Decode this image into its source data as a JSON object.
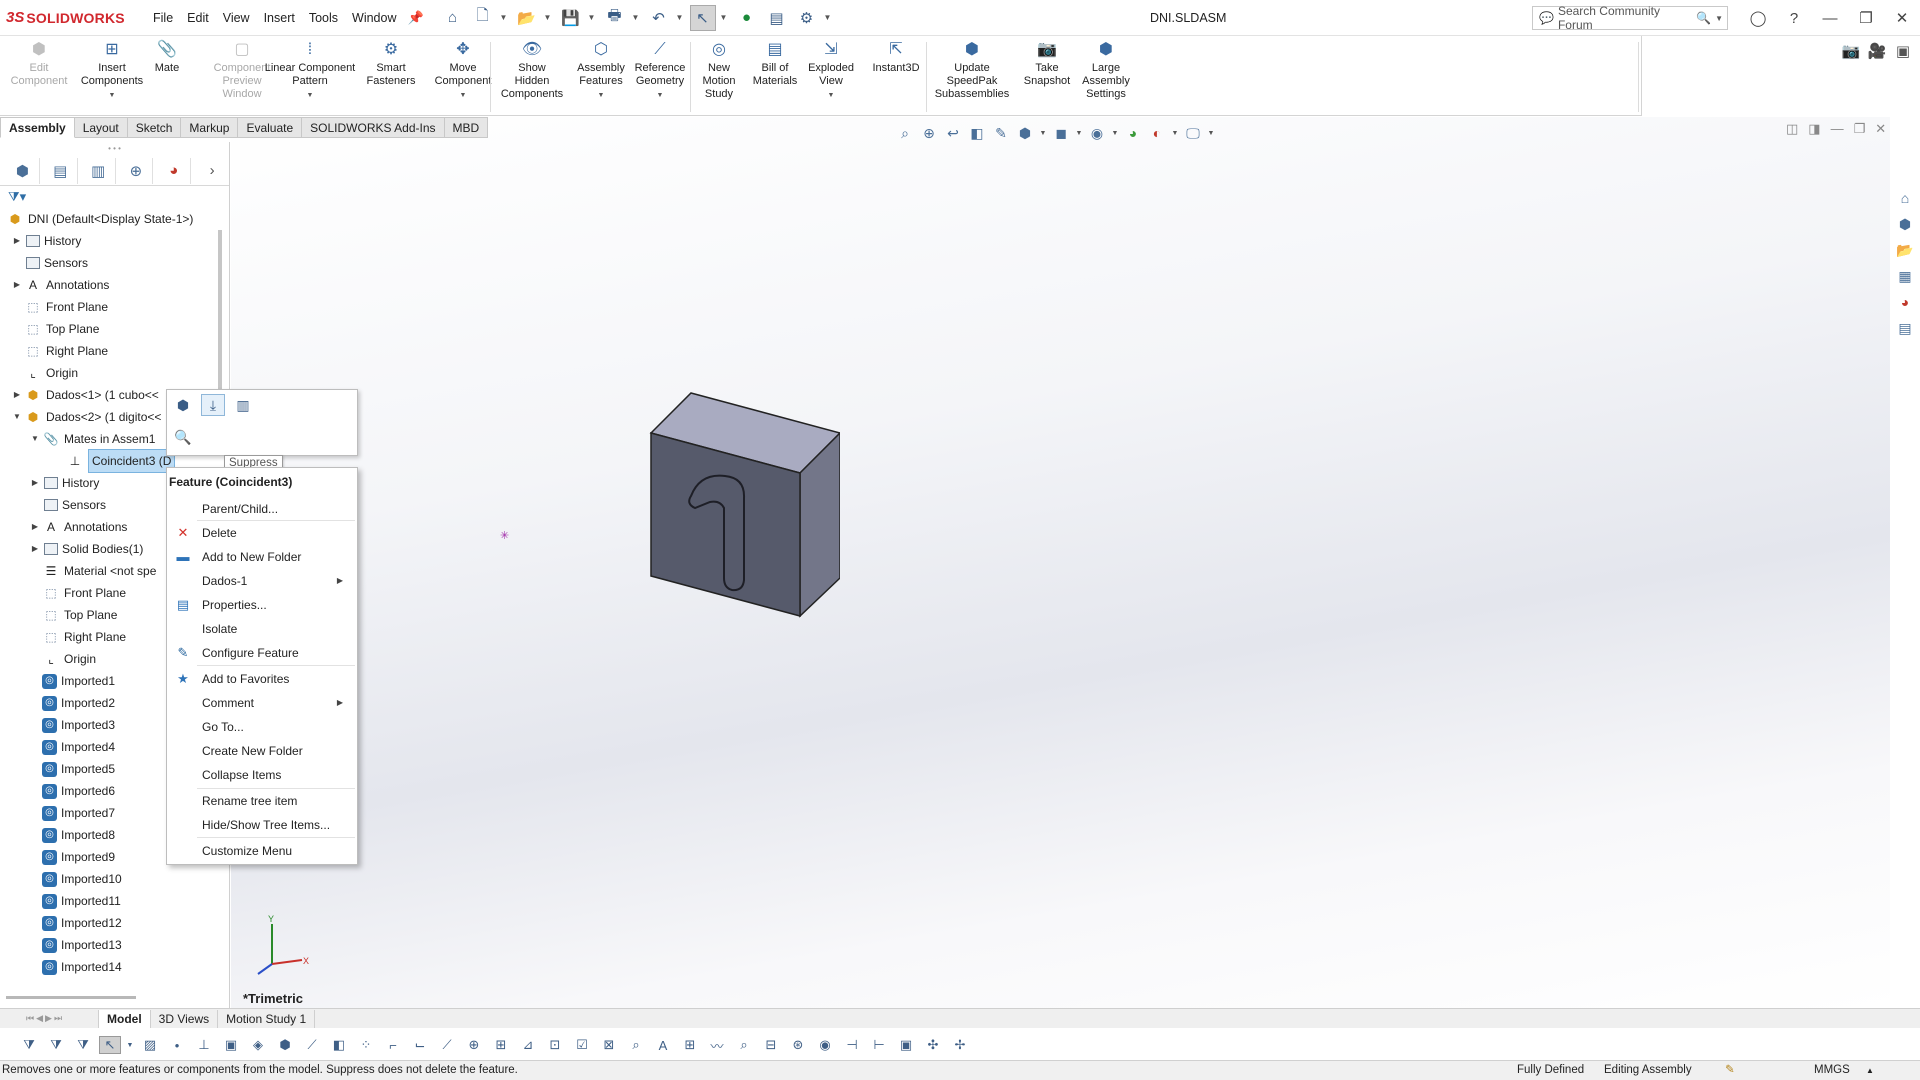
{
  "app": {
    "name": "SOLIDWORKS",
    "logo_mark": "3S",
    "document_title": "DNI.SLDASM"
  },
  "menu": [
    "File",
    "Edit",
    "View",
    "Insert",
    "Tools",
    "Window"
  ],
  "search": {
    "placeholder": "Search Community Forum"
  },
  "commands": [
    {
      "label": "Edit\nComponent",
      "icon": "edit-component-icon",
      "disabled": true
    },
    {
      "label": "Insert\nComponents",
      "icon": "insert-components-icon",
      "disabled": false
    },
    {
      "label": "Mate",
      "icon": "mate-icon",
      "disabled": false
    },
    {
      "label": "Component\nPreview\nWindow",
      "icon": "component-preview-icon",
      "disabled": true
    },
    {
      "label": "Linear Component\nPattern",
      "icon": "linear-pattern-icon",
      "disabled": false
    },
    {
      "label": "Smart\nFasteners",
      "icon": "smart-fasteners-icon",
      "disabled": false
    },
    {
      "label": "Move\nComponent",
      "icon": "move-component-icon",
      "disabled": false
    },
    {
      "label": "Show\nHidden\nComponents",
      "icon": "show-hidden-icon",
      "disabled": false
    },
    {
      "label": "Assembly\nFeatures",
      "icon": "assembly-features-icon",
      "disabled": false
    },
    {
      "label": "Reference\nGeometry",
      "icon": "reference-geometry-icon",
      "disabled": false
    },
    {
      "label": "New\nMotion\nStudy",
      "icon": "motion-study-icon",
      "disabled": false
    },
    {
      "label": "Bill of\nMaterials",
      "icon": "bom-icon",
      "disabled": false
    },
    {
      "label": "Exploded\nView",
      "icon": "exploded-view-icon",
      "disabled": false
    },
    {
      "label": "Instant3D",
      "icon": "instant3d-icon",
      "disabled": false
    },
    {
      "label": "Update\nSpeedPak\nSubassemblies",
      "icon": "speedpak-icon",
      "disabled": false
    },
    {
      "label": "Take\nSnapshot",
      "icon": "snapshot-icon",
      "disabled": false
    },
    {
      "label": "Large\nAssembly\nSettings",
      "icon": "large-assembly-icon",
      "disabled": false
    }
  ],
  "cmd_tabs": [
    "Assembly",
    "Layout",
    "Sketch",
    "Markup",
    "Evaluate",
    "SOLIDWORKS Add-Ins",
    "MBD"
  ],
  "active_cmd_tab": "Assembly",
  "tree": [
    {
      "label": "DNI  (Default<Display State-1>)",
      "icon": "assembly-icon",
      "level": 0,
      "expander": ""
    },
    {
      "label": "History",
      "icon": "folder-icon",
      "level": 1,
      "expander": "right"
    },
    {
      "label": "Sensors",
      "icon": "folder-icon",
      "level": 1,
      "expander": ""
    },
    {
      "label": "Annotations",
      "icon": "annotations-icon",
      "level": 1,
      "expander": "right"
    },
    {
      "label": "Front Plane",
      "icon": "plane-icon",
      "level": 1,
      "expander": ""
    },
    {
      "label": "Top Plane",
      "icon": "plane-icon",
      "level": 1,
      "expander": ""
    },
    {
      "label": "Right Plane",
      "icon": "plane-icon",
      "level": 1,
      "expander": ""
    },
    {
      "label": "Origin",
      "icon": "origin-icon",
      "level": 1,
      "expander": ""
    },
    {
      "label": "Dados<1> (1 cubo<<",
      "icon": "subassembly-icon",
      "level": 1,
      "expander": "right"
    },
    {
      "label": "Dados<2> (1 digito<<",
      "icon": "subassembly-icon",
      "level": 1,
      "expander": "down"
    },
    {
      "label": "Mates in Assem1",
      "icon": "mates-folder-icon",
      "level": 2,
      "expander": "down"
    },
    {
      "label": "Coincident3 (D",
      "icon": "coincident-mate-icon",
      "level": 3,
      "expander": "",
      "selected": true
    },
    {
      "label": "History",
      "icon": "folder-icon",
      "level": 2,
      "expander": "right"
    },
    {
      "label": "Sensors",
      "icon": "folder-icon",
      "level": 2,
      "expander": ""
    },
    {
      "label": "Annotations",
      "icon": "annotations-icon",
      "level": 2,
      "expander": "right"
    },
    {
      "label": "Solid Bodies(1)",
      "icon": "folder-icon",
      "level": 2,
      "expander": "right"
    },
    {
      "label": "Material <not spe",
      "icon": "material-icon",
      "level": 2,
      "expander": ""
    },
    {
      "label": "Front Plane",
      "icon": "plane-icon",
      "level": 2,
      "expander": ""
    },
    {
      "label": "Top Plane",
      "icon": "plane-icon",
      "level": 2,
      "expander": ""
    },
    {
      "label": "Right Plane",
      "icon": "plane-icon",
      "level": 2,
      "expander": ""
    },
    {
      "label": "Origin",
      "icon": "origin-icon",
      "level": 2,
      "expander": ""
    },
    {
      "label": "Imported1",
      "icon": "imported-feature-icon",
      "level": 2,
      "expander": ""
    },
    {
      "label": "Imported2",
      "icon": "imported-feature-icon",
      "level": 2,
      "expander": ""
    },
    {
      "label": "Imported3",
      "icon": "imported-feature-icon",
      "level": 2,
      "expander": ""
    },
    {
      "label": "Imported4",
      "icon": "imported-feature-icon",
      "level": 2,
      "expander": ""
    },
    {
      "label": "Imported5",
      "icon": "imported-feature-icon",
      "level": 2,
      "expander": ""
    },
    {
      "label": "Imported6",
      "icon": "imported-feature-icon",
      "level": 2,
      "expander": ""
    },
    {
      "label": "Imported7",
      "icon": "imported-feature-icon",
      "level": 2,
      "expander": ""
    },
    {
      "label": "Imported8",
      "icon": "imported-feature-icon",
      "level": 2,
      "expander": ""
    },
    {
      "label": "Imported9",
      "icon": "imported-feature-icon",
      "level": 2,
      "expander": ""
    },
    {
      "label": "Imported10",
      "icon": "imported-feature-icon",
      "level": 2,
      "expander": ""
    },
    {
      "label": "Imported11",
      "icon": "imported-feature-icon",
      "level": 2,
      "expander": ""
    },
    {
      "label": "Imported12",
      "icon": "imported-feature-icon",
      "level": 2,
      "expander": ""
    },
    {
      "label": "Imported13",
      "icon": "imported-feature-icon",
      "level": 2,
      "expander": ""
    },
    {
      "label": "Imported14",
      "icon": "imported-feature-icon",
      "level": 2,
      "expander": ""
    }
  ],
  "tooltip": "Suppress",
  "context_menu": {
    "header": "Feature (Coincident3)",
    "items": [
      {
        "label": "Parent/Child...",
        "icon": "",
        "submenu": false
      },
      {
        "label": "Delete",
        "icon": "delete-icon",
        "submenu": false
      },
      {
        "label": "Add to New Folder",
        "icon": "new-folder-icon",
        "submenu": false
      },
      {
        "label": "Dados-1",
        "icon": "",
        "submenu": true
      },
      {
        "label": "Properties...",
        "icon": "properties-icon",
        "submenu": false
      },
      {
        "label": "Isolate",
        "icon": "",
        "submenu": false
      },
      {
        "label": "Configure Feature",
        "icon": "configure-feature-icon",
        "submenu": false
      },
      {
        "label": "Add to Favorites",
        "icon": "favorites-icon",
        "submenu": false
      },
      {
        "label": "Comment",
        "icon": "",
        "submenu": true
      },
      {
        "label": "Go To...",
        "icon": "",
        "submenu": false
      },
      {
        "label": "Create New Folder",
        "icon": "",
        "submenu": false
      },
      {
        "label": "Collapse Items",
        "icon": "",
        "submenu": false
      },
      {
        "label": "Rename tree item",
        "icon": "",
        "submenu": false
      },
      {
        "label": "Hide/Show Tree Items...",
        "icon": "",
        "submenu": false
      },
      {
        "label": "Customize Menu",
        "icon": "",
        "submenu": false
      }
    ]
  },
  "viewport": {
    "view_name": "*Trimetric",
    "model_digit": "1",
    "triad": {
      "x": "X",
      "y": "Y"
    }
  },
  "bottom_tabs": [
    "Model",
    "3D Views",
    "Motion Study 1"
  ],
  "active_bottom_tab": "Model",
  "status": {
    "message": "Removes one or more features or components from the model. Suppress does not delete the feature.",
    "definition": "Fully Defined",
    "mode": "Editing Assembly",
    "units": "MMGS"
  },
  "colors": {
    "brand": "#d1282e",
    "selection": "#bcdcf5",
    "model_face_front": "#565a6b",
    "model_face_top": "#a9abc1",
    "model_face_side": "#737689"
  }
}
